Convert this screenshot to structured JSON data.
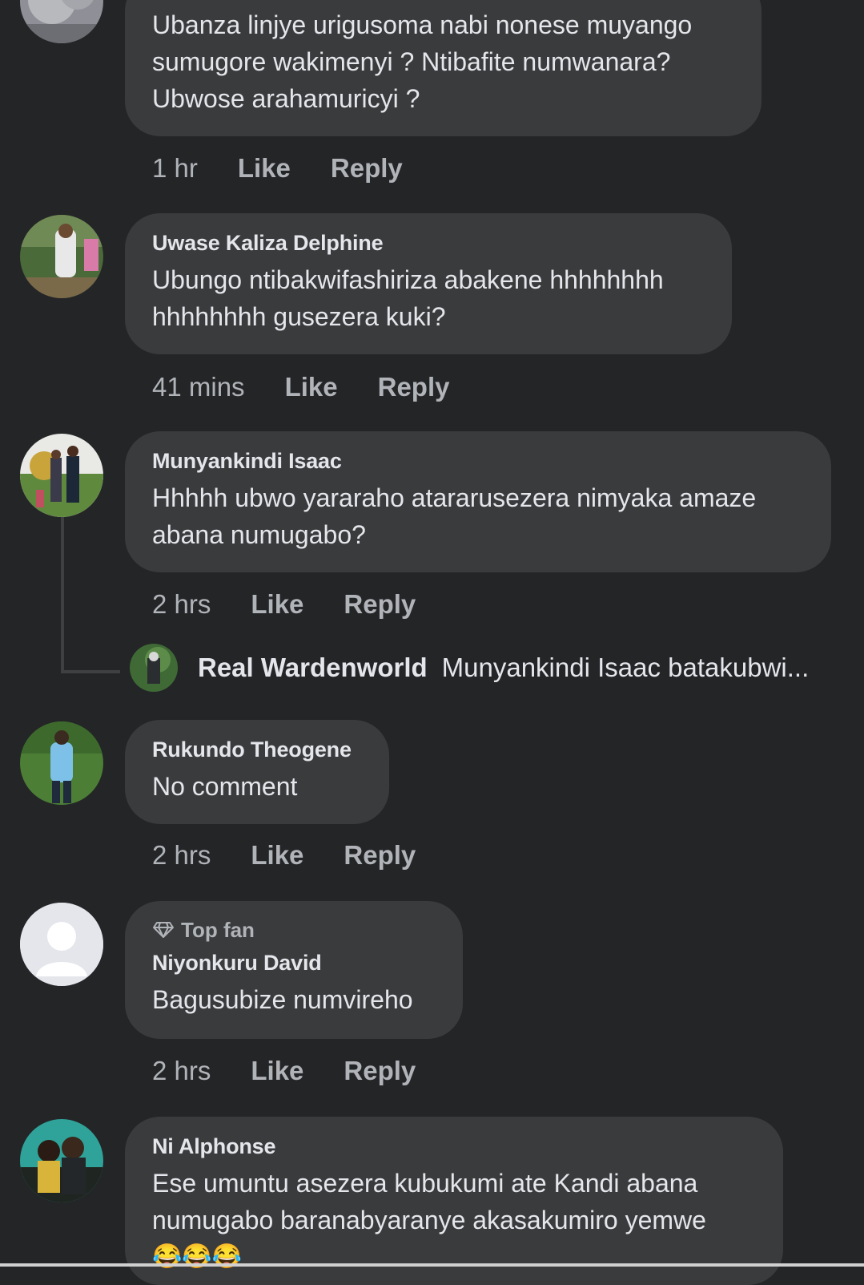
{
  "comments": [
    {
      "author": "",
      "text": "Ubanza linjye urigusoma nabi nonese muyango sumugore wakimenyi ? Ntibafite numwanara? Ubwose arahamuricyi ?",
      "time": "1 hr",
      "like_label": "Like",
      "reply_label": "Reply"
    },
    {
      "author": "Uwase Kaliza Delphine",
      "text": "Ubungo ntibakwifashiriza abakene hhhhhhhh hhhhhhhh gusezera kuki?",
      "time": "41 mins",
      "like_label": "Like",
      "reply_label": "Reply"
    },
    {
      "author": "Munyankindi Isaac",
      "text": "Hhhhh ubwo yararaho atararusezera nimyaka amaze abana numugabo?",
      "time": "2 hrs",
      "like_label": "Like",
      "reply_label": "Reply",
      "reply_preview": {
        "author": "Real Wardenworld",
        "text": "Munyankindi Isaac batakubwi..."
      }
    },
    {
      "author": "Rukundo Theogene",
      "text": "No comment",
      "time": "2 hrs",
      "like_label": "Like",
      "reply_label": "Reply"
    },
    {
      "badge": "Top fan",
      "author": "Niyonkuru David",
      "text": "Bagusubize numvireho",
      "time": "2 hrs",
      "like_label": "Like",
      "reply_label": "Reply"
    },
    {
      "author": "Ni Alphonse",
      "text": "Ese umuntu asezera kubukumi ate Kandi abana numugabo baranabyaranye akasakumiro yemwe",
      "emoji": "😂😂😂"
    }
  ],
  "icons": {
    "badge_icon": "diamond-icon",
    "default_avatar": "default-profile-icon"
  },
  "colors": {
    "background": "#242527",
    "bubble": "#3a3b3c",
    "primary_text": "#e4e6eb",
    "secondary_text": "#b0b3b8"
  }
}
